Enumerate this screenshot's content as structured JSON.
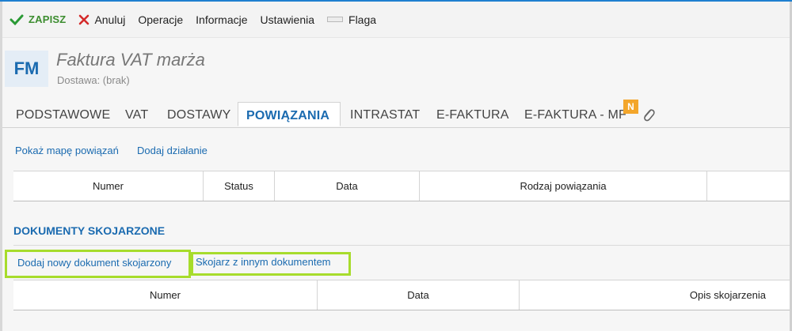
{
  "toolbar": {
    "save_label": "ZAPISZ",
    "cancel_label": "Anuluj",
    "operations_label": "Operacje",
    "info_label": "Informacje",
    "settings_label": "Ustawienia",
    "flag_label": "Flaga"
  },
  "header": {
    "badge": "FM",
    "title": "Faktura VAT marża",
    "subtitle": "Dostawa: (brak)"
  },
  "tabs": [
    {
      "label": "PODSTAWOWE"
    },
    {
      "label": "VAT"
    },
    {
      "label": "DOSTAWY"
    },
    {
      "label": "POWIĄZANIA"
    },
    {
      "label": "INTRASTAT"
    },
    {
      "label": "E-FAKTURA"
    },
    {
      "label": "E-FAKTURA - MF"
    }
  ],
  "tab_badge": "N",
  "links_section": {
    "show_map": "Pokaż mapę powiązań",
    "add_action": "Dodaj działanie"
  },
  "relations_table": {
    "columns": [
      "Numer",
      "Status",
      "Data",
      "Rodzaj powiązania"
    ]
  },
  "matched_section": {
    "title": "DOKUMENTY SKOJARZONE",
    "add_new": "Dodaj nowy dokument skojarzony",
    "match_other": "Skojarz z innym dokumentem",
    "columns": [
      "Numer",
      "Data",
      "Opis skojarzenia"
    ]
  },
  "colors": {
    "accent": "#1b6bb0",
    "highlight": "#a7dc2c",
    "badge": "#f3a62b",
    "save": "#3c8d2f",
    "cancel": "#d42a2a"
  }
}
